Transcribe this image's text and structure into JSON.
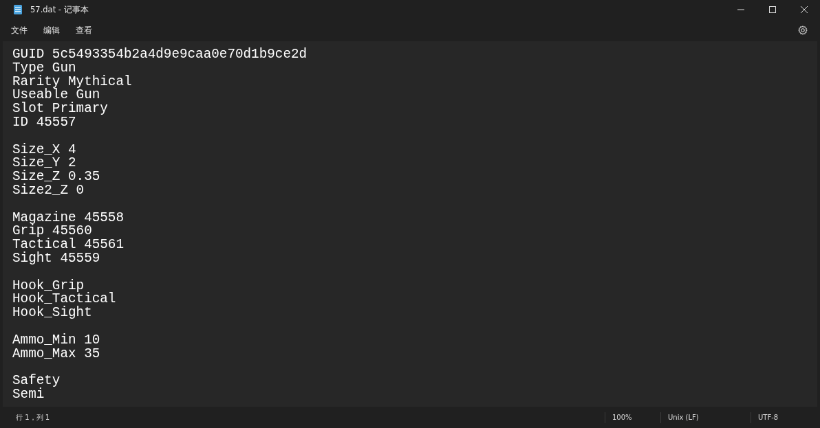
{
  "window": {
    "title": "57.dat - 记事本"
  },
  "menu": [
    "文件",
    "编辑",
    "查看"
  ],
  "document": {
    "paragraphs": [
      [
        "GUID 5c5493354b2a4d9e9caa0e70d1b9ce2d",
        "Type Gun",
        "Rarity Mythical",
        "Useable Gun",
        "Slot Primary",
        "ID 45557"
      ],
      [
        "Size_X 4",
        "Size_Y 2",
        "Size_Z 0.35",
        "Size2_Z 0"
      ],
      [
        "Magazine 45558",
        "Grip 45560",
        "Tactical 45561",
        "Sight 45559"
      ],
      [
        "Hook_Grip",
        "Hook_Tactical",
        "Hook_Sight"
      ],
      [
        "Ammo_Min 10",
        "Ammo_Max 35"
      ],
      [
        "Safety",
        "Semi"
      ]
    ]
  },
  "status_bar": {
    "position": "行 1，列 1",
    "zoom": "100%",
    "line_ending": "Unix (LF)",
    "encoding": "UTF-8"
  }
}
